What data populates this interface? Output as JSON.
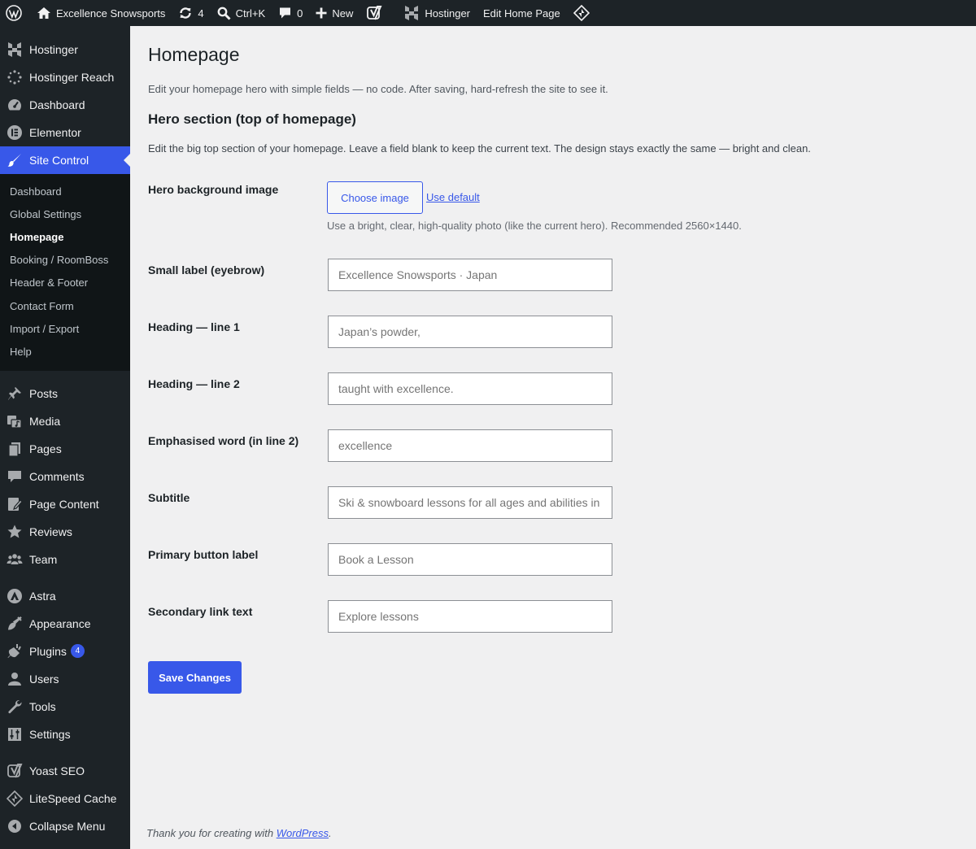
{
  "admin_bar": {
    "site_name": "Excellence Snowsports",
    "updates_count": "4",
    "search_shortcut": "Ctrl+K",
    "comments_count": "0",
    "new_label": "New",
    "hostinger_label": "Hostinger",
    "edit_page_label": "Edit Home Page"
  },
  "sidebar": {
    "items_top": [
      {
        "label": "Hostinger",
        "icon": "hostinger-icon"
      },
      {
        "label": "Hostinger Reach",
        "icon": "reach-icon"
      },
      {
        "label": "Dashboard",
        "icon": "dashboard-icon"
      },
      {
        "label": "Elementor",
        "icon": "elementor-icon"
      },
      {
        "label": "Site Control",
        "icon": "brush-icon"
      }
    ],
    "submenu": [
      {
        "label": "Dashboard"
      },
      {
        "label": "Global Settings"
      },
      {
        "label": "Homepage"
      },
      {
        "label": "Booking / RoomBoss"
      },
      {
        "label": "Header & Footer"
      },
      {
        "label": "Contact Form"
      },
      {
        "label": "Import / Export"
      },
      {
        "label": "Help"
      }
    ],
    "items_mid": [
      {
        "label": "Posts",
        "icon": "pin-icon"
      },
      {
        "label": "Media",
        "icon": "media-icon"
      },
      {
        "label": "Pages",
        "icon": "pages-icon"
      },
      {
        "label": "Comments",
        "icon": "comment-icon"
      },
      {
        "label": "Page Content",
        "icon": "page-content-icon"
      },
      {
        "label": "Reviews",
        "icon": "star-icon"
      },
      {
        "label": "Team",
        "icon": "team-icon"
      }
    ],
    "items_low": [
      {
        "label": "Astra",
        "icon": "astra-icon"
      },
      {
        "label": "Appearance",
        "icon": "appearance-icon"
      },
      {
        "label": "Plugins",
        "icon": "plugin-icon",
        "badge": "4"
      },
      {
        "label": "Users",
        "icon": "user-icon"
      },
      {
        "label": "Tools",
        "icon": "wrench-icon"
      },
      {
        "label": "Settings",
        "icon": "settings-icon"
      }
    ],
    "items_bottom": [
      {
        "label": "Yoast SEO",
        "icon": "yoast-icon"
      },
      {
        "label": "LiteSpeed Cache",
        "icon": "litespeed-icon"
      },
      {
        "label": "Collapse Menu",
        "icon": "collapse-icon"
      }
    ]
  },
  "main": {
    "title": "Homepage",
    "intro": "Edit your homepage hero with simple fields — no code. After saving, hard-refresh the site to see it.",
    "section_title": "Hero section (top of homepage)",
    "section_desc": "Edit the big top section of your homepage. Leave a field blank to keep the current text. The design stays exactly the same — bright and clean.",
    "bg_image": {
      "label": "Hero background image",
      "choose_label": "Choose image",
      "default_label": "Use default",
      "description": "Use a bright, clear, high-quality photo (like the current hero). Recommended 2560×1440."
    },
    "fields": [
      {
        "label": "Small label (eyebrow)",
        "placeholder": "Excellence Snowsports · Japan"
      },
      {
        "label": "Heading — line 1",
        "placeholder": "Japan’s powder,"
      },
      {
        "label": "Heading — line 2",
        "placeholder": "taught with excellence."
      },
      {
        "label": "Emphasised word (in line 2)",
        "placeholder": "excellence"
      },
      {
        "label": "Subtitle",
        "placeholder": "Ski & snowboard lessons for all ages and abilities in Niseko"
      },
      {
        "label": "Primary button label",
        "placeholder": "Book a Lesson"
      },
      {
        "label": "Secondary link text",
        "placeholder": "Explore lessons"
      }
    ],
    "save_label": "Save Changes"
  },
  "footer": {
    "text": "Thank you for creating with",
    "link": "WordPress",
    "end": "."
  },
  "colors": {
    "accent": "#3858e9",
    "admin_bg": "#1d2327",
    "content_bg": "#f0f0f1"
  }
}
